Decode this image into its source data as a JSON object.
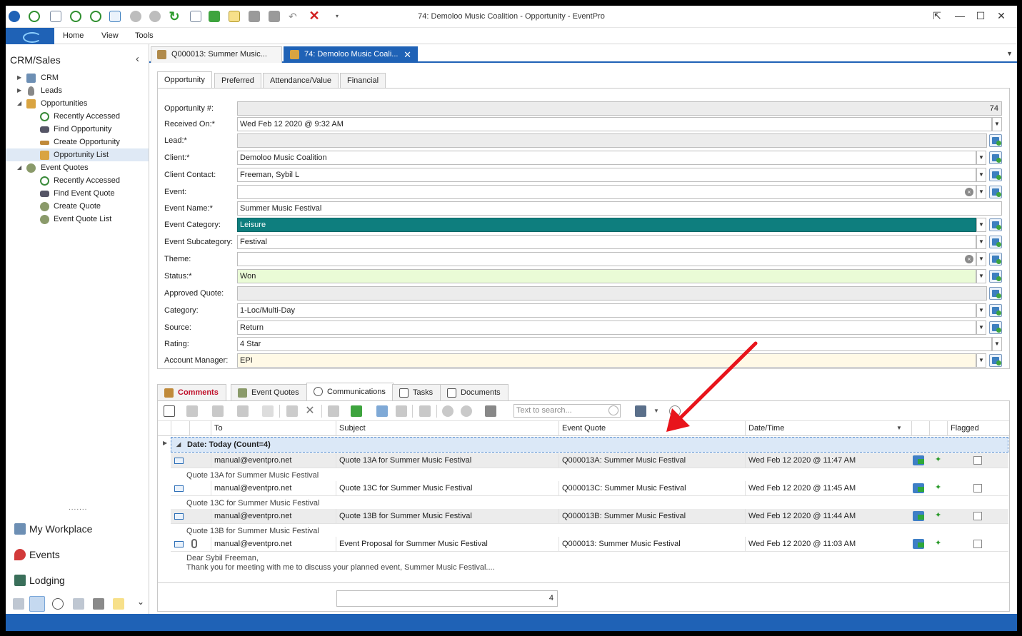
{
  "window": {
    "title": "74: Demoloo Music Coalition - Opportunity - EventPro"
  },
  "ribbon": {
    "tabs": [
      "Home",
      "View",
      "Tools"
    ]
  },
  "sidebar": {
    "title": "CRM/Sales",
    "items": [
      {
        "label": "CRM"
      },
      {
        "label": "Leads"
      },
      {
        "label": "Opportunities"
      },
      {
        "label": "Recently Accessed"
      },
      {
        "label": "Find Opportunity"
      },
      {
        "label": "Create Opportunity"
      },
      {
        "label": "Opportunity List"
      },
      {
        "label": "Event Quotes"
      },
      {
        "label": "Recently Accessed"
      },
      {
        "label": "Find Event Quote"
      },
      {
        "label": "Create Quote"
      },
      {
        "label": "Event Quote List"
      }
    ],
    "nav": [
      {
        "label": "My Workplace"
      },
      {
        "label": "Events"
      },
      {
        "label": "Lodging"
      }
    ]
  },
  "doc_tabs": [
    {
      "label": "Q000013: Summer Music..."
    },
    {
      "label": "74: Demoloo Music Coali..."
    }
  ],
  "form_tabs": [
    "Opportunity",
    "Preferred",
    "Attendance/Value",
    "Financial"
  ],
  "fields": {
    "opportunity_no": {
      "label": "Opportunity #:",
      "value": "74"
    },
    "received_on": {
      "label": "Received On:*",
      "value": "Wed Feb 12 2020 @ 9:32 AM"
    },
    "lead": {
      "label": "Lead:*",
      "value": ""
    },
    "client": {
      "label": "Client:*",
      "value": "Demoloo Music Coalition"
    },
    "client_contact": {
      "label": "Client Contact:",
      "value": "Freeman, Sybil L"
    },
    "event": {
      "label": "Event:",
      "value": ""
    },
    "event_name": {
      "label": "Event Name:*",
      "value": "Summer Music Festival"
    },
    "event_category": {
      "label": "Event Category:",
      "value": "Leisure"
    },
    "event_subcategory": {
      "label": "Event Subcategory:",
      "value": "Festival"
    },
    "theme": {
      "label": "Theme:",
      "value": ""
    },
    "status": {
      "label": "Status:*",
      "value": "Won"
    },
    "approved_quote": {
      "label": "Approved Quote:",
      "value": ""
    },
    "category": {
      "label": "Category:",
      "value": "1-Loc/Multi-Day"
    },
    "source": {
      "label": "Source:",
      "value": "Return"
    },
    "rating": {
      "label": "Rating:",
      "value": "4 Star"
    },
    "account_manager": {
      "label": "Account Manager:",
      "value": "EPI"
    }
  },
  "bottom_tabs": [
    "Comments",
    "Event Quotes",
    "Communications",
    "Tasks",
    "Documents"
  ],
  "comm": {
    "search_placeholder": "Text to search...",
    "columns": [
      "To",
      "Subject",
      "Event Quote",
      "Date/Time",
      "Flagged"
    ],
    "group": "Date: Today (Count=4)",
    "rows": [
      {
        "to": "manual@eventpro.net",
        "subject": "Quote 13A for Summer Music Festival",
        "quote": "Q000013A: Summer Music Festival",
        "datetime": "Wed Feb 12 2020 @ 11:47 AM",
        "preview1": "Quote 13A for Summer Music Festival",
        "preview2": ""
      },
      {
        "to": "manual@eventpro.net",
        "subject": "Quote 13C for Summer Music Festival",
        "quote": "Q000013C: Summer Music Festival",
        "datetime": "Wed Feb 12 2020 @ 11:45 AM",
        "preview1": "Quote 13C for Summer Music Festival",
        "preview2": ""
      },
      {
        "to": "manual@eventpro.net",
        "subject": "Quote 13B for Summer Music Festival",
        "quote": "Q000013B: Summer Music Festival",
        "datetime": "Wed Feb 12 2020 @ 11:44 AM",
        "preview1": "Quote 13B for Summer Music Festival",
        "preview2": ""
      },
      {
        "to": "manual@eventpro.net",
        "subject": "Event Proposal for Summer Music Festival",
        "quote": "Q000013: Summer Music Festival",
        "datetime": "Wed Feb 12 2020 @ 11:03 AM",
        "preview1": "Dear Sybil Freeman,",
        "preview2": "Thank you for meeting with me to discuss your planned event, Summer Music Festival...."
      }
    ],
    "footer_count": "4"
  },
  "colors": {
    "accent": "#1f62b6",
    "category": "#0e7e7e",
    "status": "#eafbd6",
    "annotation_arrow": "#e8141b"
  }
}
